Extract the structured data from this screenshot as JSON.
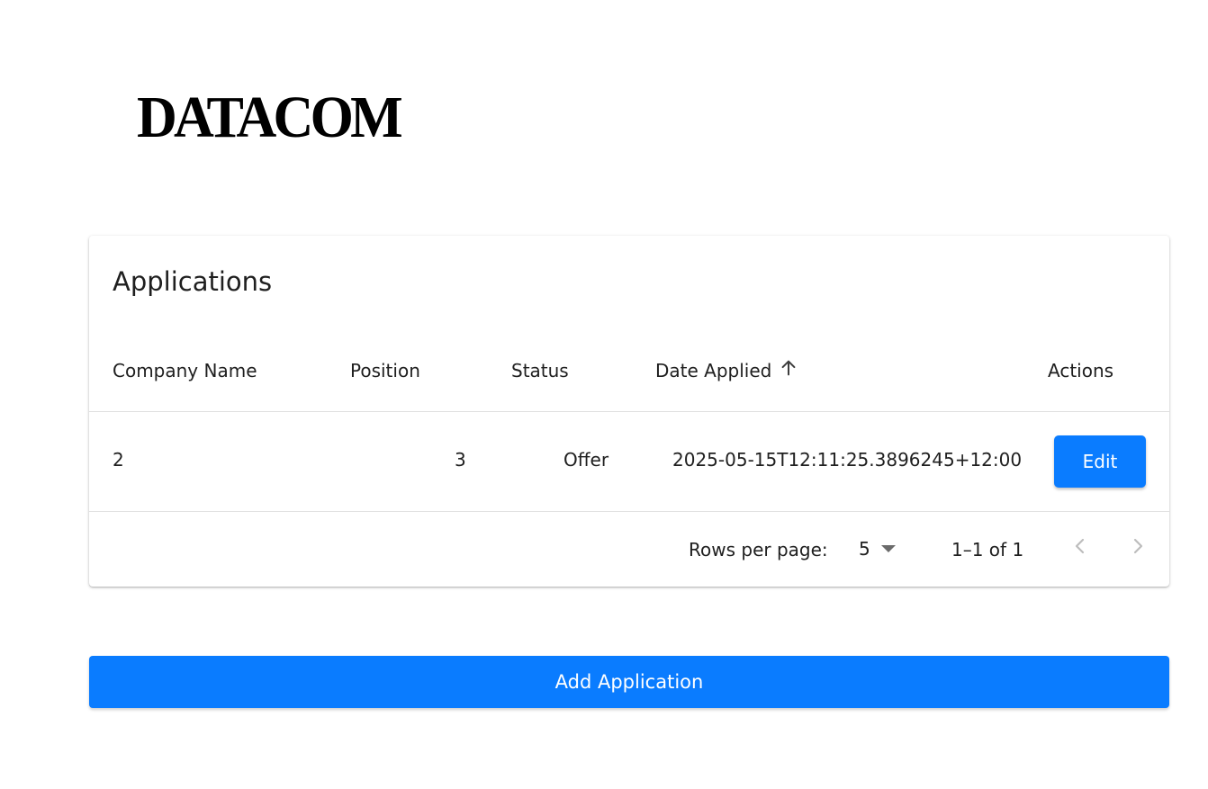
{
  "brand": {
    "logo_text": "DATACOM"
  },
  "applications_table": {
    "title": "Applications",
    "columns": [
      {
        "label": "Company Name"
      },
      {
        "label": "Position"
      },
      {
        "label": "Status"
      },
      {
        "label": "Date Applied",
        "sort": "ascending",
        "sort_icon": "arrow-up-icon"
      },
      {
        "label": "Actions"
      }
    ],
    "rows": [
      {
        "company_name": "2",
        "position": "3",
        "status": "Offer",
        "date_applied": "2025-05-15T12:11:25.3896245+12:00",
        "action_label": "Edit"
      }
    ],
    "pagination": {
      "rows_per_page_label": "Rows per page:",
      "rows_per_page_value": "5",
      "range_text": "1–1 of 1",
      "prev_icon": "chevron-left-icon",
      "next_icon": "chevron-right-icon"
    }
  },
  "add_button_label": "Add Application",
  "colors": {
    "accent": "#0a7cff",
    "divider": "#e0e0e0",
    "disabled_icon": "#bdbdbd"
  }
}
